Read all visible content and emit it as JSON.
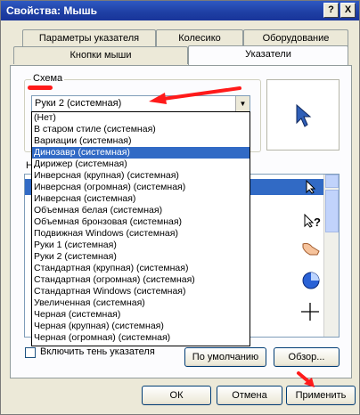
{
  "window": {
    "title": "Свойства: Мышь",
    "help_glyph": "?",
    "close_glyph": "X"
  },
  "tabs": {
    "row1": [
      "Параметры указателя",
      "Колесико",
      "Оборудование"
    ],
    "row2": [
      "Кнопки мыши",
      "Указатели"
    ],
    "active": "Указатели"
  },
  "scheme": {
    "label": "Схема",
    "selected": "Руки 2 (системная)"
  },
  "dropdown": {
    "items": [
      "(Нет)",
      "В старом стиле (системная)",
      "Вариации (системная)",
      "Динозавр (системная)",
      "Дирижер (системная)",
      "Инверсная (крупная) (системная)",
      "Инверсная (огромная) (системная)",
      "Инверсная (системная)",
      "Объемная белая (системная)",
      "Объемная бронзовая (системная)",
      "Подвижная Windows (системная)",
      "Руки 1 (системная)",
      "Руки 2 (системная)",
      "Стандартная (крупная) (системная)",
      "Стандартная (огромная) (системная)",
      "Стандартная Windows (системная)",
      "Увеличенная (системная)",
      "Черная  (системная)",
      "Черная (крупная) (системная)",
      "Черная (огромная) (системная)"
    ],
    "highlighted": "Динозавр (системная)"
  },
  "customize_label_fragment": "Н",
  "cursor_list_icons": [
    "arrow-cursor-icon",
    "help-cursor-icon",
    "hand-cursor-icon",
    "busy-cursor-icon",
    "crosshair-cursor-icon"
  ],
  "shadow_checkbox": {
    "label": "Включить тень указателя",
    "checked": false
  },
  "buttons": {
    "default": "По умолчанию",
    "browse": "Обзор...",
    "ok": "ОК",
    "cancel": "Отмена",
    "apply": "Применить"
  },
  "colors": {
    "selection": "#316ac5",
    "annotation_red": "#ff1a1a",
    "titlebar": "#1e3fa3"
  }
}
